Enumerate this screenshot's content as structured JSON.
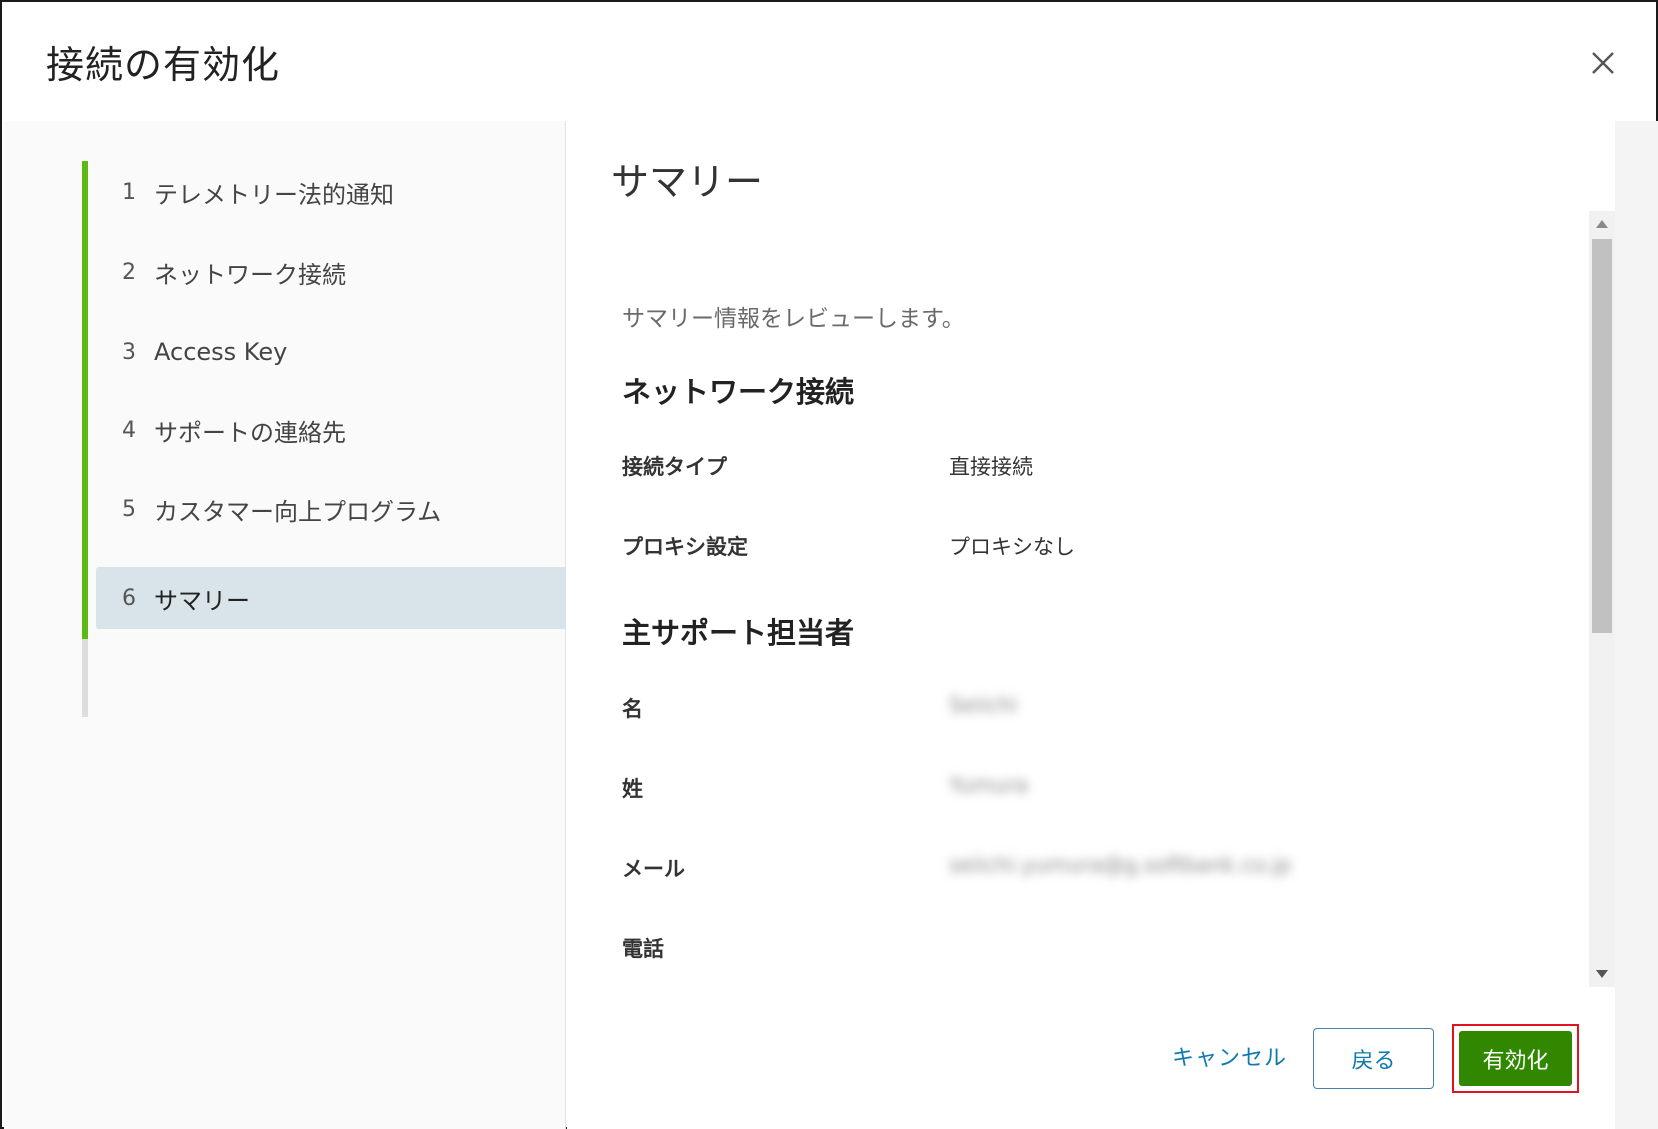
{
  "dialog": {
    "title": "接続の有効化",
    "close_icon": "close-icon"
  },
  "steps": [
    {
      "num": "1",
      "label": "テレメトリー法的通知"
    },
    {
      "num": "2",
      "label": "ネットワーク接続"
    },
    {
      "num": "3",
      "label": "Access Key"
    },
    {
      "num": "4",
      "label": "サポートの連絡先"
    },
    {
      "num": "5",
      "label": "カスタマー向上プログラム"
    },
    {
      "num": "6",
      "label": "サマリー"
    }
  ],
  "summary": {
    "title": "サマリー",
    "intro": "サマリー情報をレビューします。",
    "network": {
      "heading": "ネットワーク接続",
      "connection_type_label": "接続タイプ",
      "connection_type_value": "直接接続",
      "proxy_label": "プロキシ設定",
      "proxy_value": "プロキシなし"
    },
    "contact": {
      "heading": "主サポート担当者",
      "first_name_label": "名",
      "first_name_value": "Seiichi",
      "last_name_label": "姓",
      "last_name_value": "Yumura",
      "email_label": "メール",
      "email_value": "seiichi.yumura@g.softbank.co.jp",
      "phone_label": "電話"
    }
  },
  "footer": {
    "cancel_label": "キャンセル",
    "back_label": "戻る",
    "enable_label": "有効化"
  },
  "colors": {
    "accent_green": "#5eb715",
    "primary_button": "#318700",
    "link_blue": "#0f79b0",
    "active_step_bg": "#d9e4ea",
    "highlight_red": "#e0141e"
  }
}
